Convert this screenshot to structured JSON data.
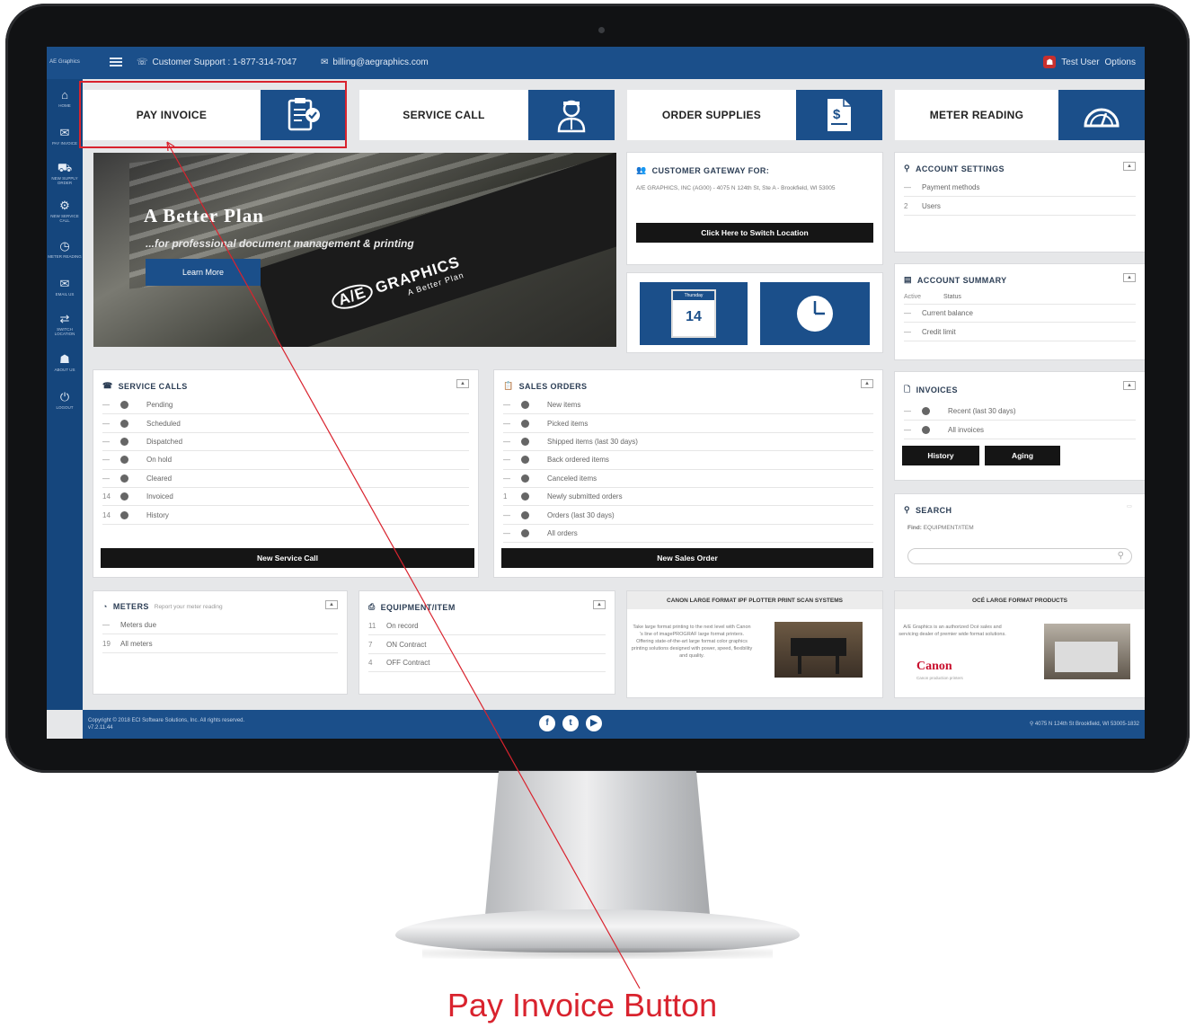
{
  "topbar": {
    "brand_mini": "AE Graphics",
    "support": "Customer Support : 1-877-314-7047",
    "email": "billing@aegraphics.com",
    "user": "Test User",
    "options": "Options"
  },
  "sidenav": [
    {
      "icon": "home-icon",
      "glyph": "⌂",
      "label": "HOME"
    },
    {
      "icon": "pay-invoice-icon",
      "glyph": "✉",
      "label": "PAY INVOICE"
    },
    {
      "icon": "supply-order-icon",
      "glyph": "⛟",
      "label": "NEW SUPPLY ORDER"
    },
    {
      "icon": "service-call-icon",
      "glyph": "⚙",
      "label": "NEW SERVICE CALL"
    },
    {
      "icon": "meter-reading-icon",
      "glyph": "◷",
      "label": "METER READING"
    },
    {
      "icon": "email-icon",
      "glyph": "✉",
      "label": "EMAIL US"
    },
    {
      "icon": "switch-location-icon",
      "glyph": "⇄",
      "label": "SWITCH LOCATION"
    },
    {
      "icon": "about-icon",
      "glyph": "☗",
      "label": "ABOUT US"
    },
    {
      "icon": "logout-icon",
      "glyph": "⏻",
      "label": "LOGOUT"
    }
  ],
  "tiles": {
    "pay_invoice": "PAY INVOICE",
    "service_call": "SERVICE CALL",
    "order_supplies": "ORDER SUPPLIES",
    "meter_reading": "METER READING"
  },
  "hero": {
    "title": "A Better Plan",
    "subtitle": "...for professional document management & printing",
    "button": "Learn More",
    "logo_ae": "A/E",
    "logo_name": "GRAPHICS",
    "logo_tag": "A Better Plan"
  },
  "gateway": {
    "title": "CUSTOMER GATEWAY FOR:",
    "address": "A/E GRAPHICS, INC (AG00) - 4075 N 124th St, Ste A - Brookfield, WI 53005",
    "button": "Click Here to Switch Location"
  },
  "calendar": {
    "day": "Thursday",
    "date": "14"
  },
  "account_settings": {
    "title": "ACCOUNT SETTINGS",
    "rows": [
      {
        "count": "—",
        "label": "Payment methods"
      },
      {
        "count": "2",
        "label": "Users"
      }
    ]
  },
  "account_summary": {
    "title": "ACCOUNT SUMMARY",
    "header": {
      "col1": "Active",
      "col2": "Status"
    },
    "rows": [
      {
        "count": "—",
        "label": "Current balance"
      },
      {
        "count": "—",
        "label": "Credit limit"
      }
    ]
  },
  "service_calls": {
    "title": "SERVICE CALLS",
    "rows": [
      {
        "count": "—",
        "label": "Pending"
      },
      {
        "count": "—",
        "label": "Scheduled"
      },
      {
        "count": "—",
        "label": "Dispatched"
      },
      {
        "count": "—",
        "label": "On hold"
      },
      {
        "count": "—",
        "label": "Cleared"
      },
      {
        "count": "14",
        "label": "Invoiced"
      },
      {
        "count": "14",
        "label": "History"
      }
    ],
    "button": "New Service Call"
  },
  "sales_orders": {
    "title": "SALES ORDERS",
    "rows": [
      {
        "count": "—",
        "label": "New items"
      },
      {
        "count": "—",
        "label": "Picked items"
      },
      {
        "count": "—",
        "label": "Shipped items (last 30 days)"
      },
      {
        "count": "—",
        "label": "Back ordered items"
      },
      {
        "count": "—",
        "label": "Canceled items"
      },
      {
        "count": "1",
        "label": "Newly submitted orders"
      },
      {
        "count": "—",
        "label": "Orders (last 30 days)"
      },
      {
        "count": "—",
        "label": "All orders"
      }
    ],
    "button": "New Sales Order"
  },
  "invoices": {
    "title": "INVOICES",
    "rows": [
      {
        "count": "—",
        "label": "Recent (last 30 days)"
      },
      {
        "count": "—",
        "label": "All invoices"
      }
    ],
    "history": "History",
    "aging": "Aging"
  },
  "search": {
    "title": "SEARCH",
    "find_label": "Find:",
    "find_value": "EQUIPMENT/ITEM",
    "placeholder": ""
  },
  "meters": {
    "title": "METERS",
    "subtitle": "Report your meter reading",
    "rows": [
      {
        "count": "—",
        "label": "Meters due"
      },
      {
        "count": "19",
        "label": "All meters"
      }
    ]
  },
  "equipment": {
    "title": "EQUIPMENT/ITEM",
    "rows": [
      {
        "count": "11",
        "label": "On record"
      },
      {
        "count": "7",
        "label": "ON Contract"
      },
      {
        "count": "4",
        "label": "OFF Contract"
      }
    ]
  },
  "canon_promo": {
    "title": "CANON LARGE FORMAT IPF PLOTTER PRINT SCAN SYSTEMS",
    "text": "Take large format printing to the next level with Canon 's line of imagePROGRAF large format printers. Offering state-of-the-art large format color graphics printing solutions designed with power, speed, flexibility and quality."
  },
  "oce_promo": {
    "title": "OCÉ LARGE FORMAT PRODUCTS",
    "text": "A/E Graphics is an authorized Océ sales and servicing dealer of premier wide format solutions.",
    "brand": "Canon",
    "brand_sub": "Canon production printers"
  },
  "footer": {
    "copyright": "Copyright © 2018 ECI Software Solutions, Inc. All rights reserved.",
    "version": "v7.2.11.44",
    "address": "4075 N 124th St Brookfield, WI 53005-1832",
    "social": [
      "f",
      "t",
      "▶"
    ]
  },
  "annotation": {
    "label": "Pay Invoice Button",
    "color": "#d9232e"
  },
  "colors": {
    "brand_blue": "#1b4f8a",
    "dark_button": "#151515",
    "screen_bg": "#e6e7e9"
  }
}
